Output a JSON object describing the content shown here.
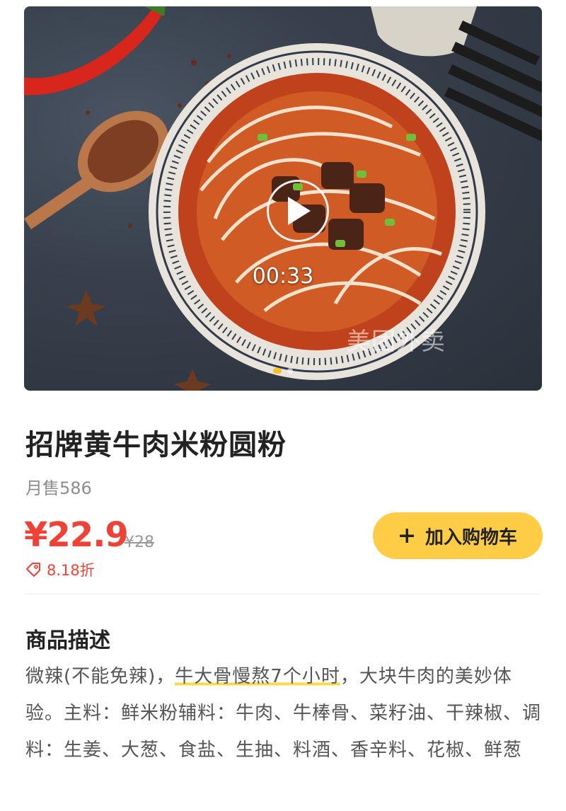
{
  "media": {
    "duration": "00:33",
    "watermark": "美团外卖"
  },
  "product": {
    "title": "招牌黄牛肉米粉圆粉",
    "monthly_sales": "月售586",
    "price": "¥22.9",
    "original_price": "¥28",
    "discount": "8.18折",
    "add_to_cart": "加入购物车"
  },
  "description": {
    "heading": "商品描述",
    "text_before": "微辣(不能免辣)，",
    "highlight": "牛大骨慢熬7个小时",
    "text_after": "，大块牛肉的美妙体验。主料：鲜米粉辅料：牛肉、牛棒骨、菜籽油、干辣椒、调料：生姜、大葱、食盐、生抽、料酒、香辛料、花椒、鲜葱"
  },
  "colors": {
    "price_red": "#ef4136",
    "cart_button": "#fecd45",
    "highlight_underline": "#fcd84a"
  }
}
